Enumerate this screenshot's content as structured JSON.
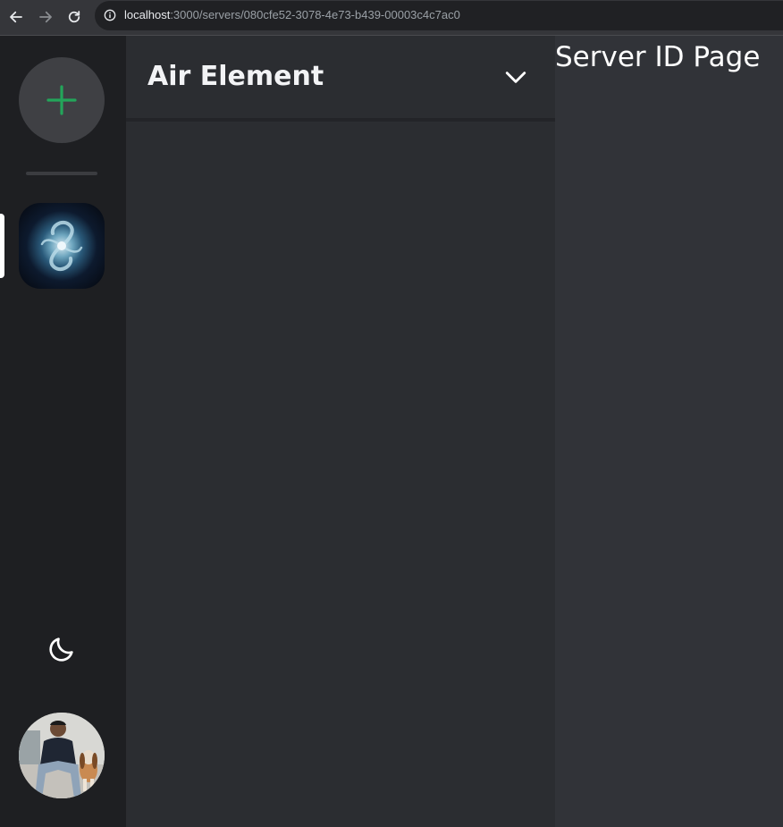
{
  "browser": {
    "url_host": "localhost",
    "url_rest": ":3000/servers/080cfe52-3078-4e73-b439-00003c4c7ac0",
    "icons": [
      "back-arrow-icon",
      "forward-arrow-icon",
      "reload-icon",
      "info-icon"
    ]
  },
  "rail": {
    "add_server_icon": "plus-icon",
    "add_color": "#23a55a",
    "servers": [
      {
        "icon": "galaxy-image",
        "active": true
      }
    ],
    "theme_icon": "moon-icon",
    "avatar": "user-photo"
  },
  "sidebar": {
    "server_name": "Air Element",
    "dropdown_icon": "chevron-down-icon"
  },
  "main": {
    "title": "Server ID Page"
  },
  "colors": {
    "rail_bg": "#1e1f22",
    "sidebar_bg": "#2b2d31",
    "main_bg": "#313338",
    "accent_green": "#23a55a"
  }
}
